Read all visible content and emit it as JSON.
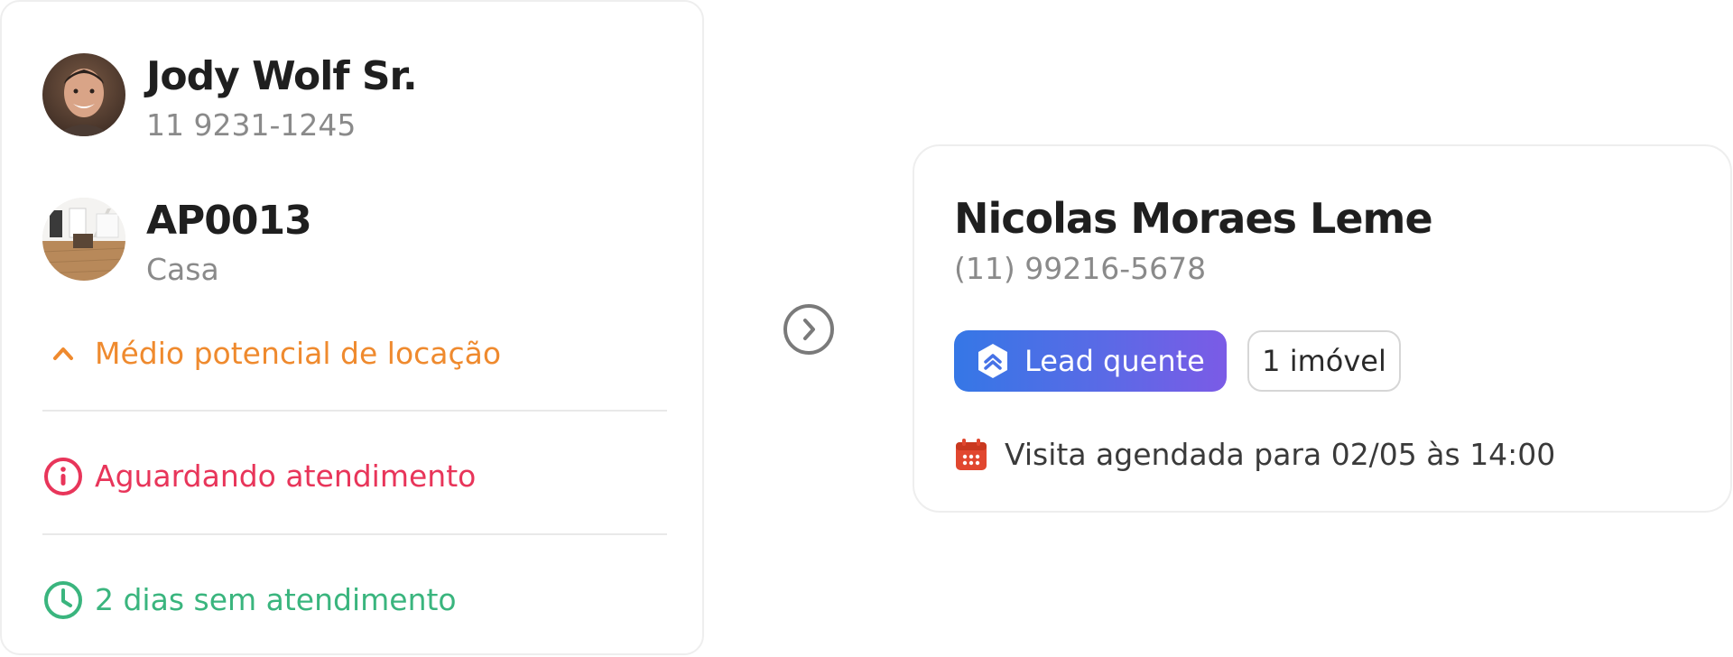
{
  "contact": {
    "name": "Jody Wolf Sr.",
    "phone": "11 9231-1245"
  },
  "property": {
    "code": "AP0013",
    "type": "Casa"
  },
  "statuses": {
    "potential": {
      "label": "Médio potencial de locação",
      "color": "#ef8a2e",
      "icon": "chevron-up-icon"
    },
    "waiting": {
      "label": "Aguardando atendimento",
      "color": "#e8355a",
      "icon": "info-icon"
    },
    "days": {
      "label": "2 dias sem atendimento",
      "color": "#3ab57e",
      "icon": "clock-icon"
    }
  },
  "agent": {
    "name": "Nicolas Moraes Leme",
    "phone": "(11) 99216-5678",
    "lead_badge": {
      "label": "Lead quente",
      "icon": "hot-lead-icon"
    },
    "properties_badge": "1 imóvel",
    "visit": {
      "label": "Visita agendada para 02/05 às 14:00",
      "icon": "calendar-icon",
      "color": "#e1472f"
    }
  },
  "navigation": {
    "arrow_icon": "chevron-right-circle-icon"
  }
}
